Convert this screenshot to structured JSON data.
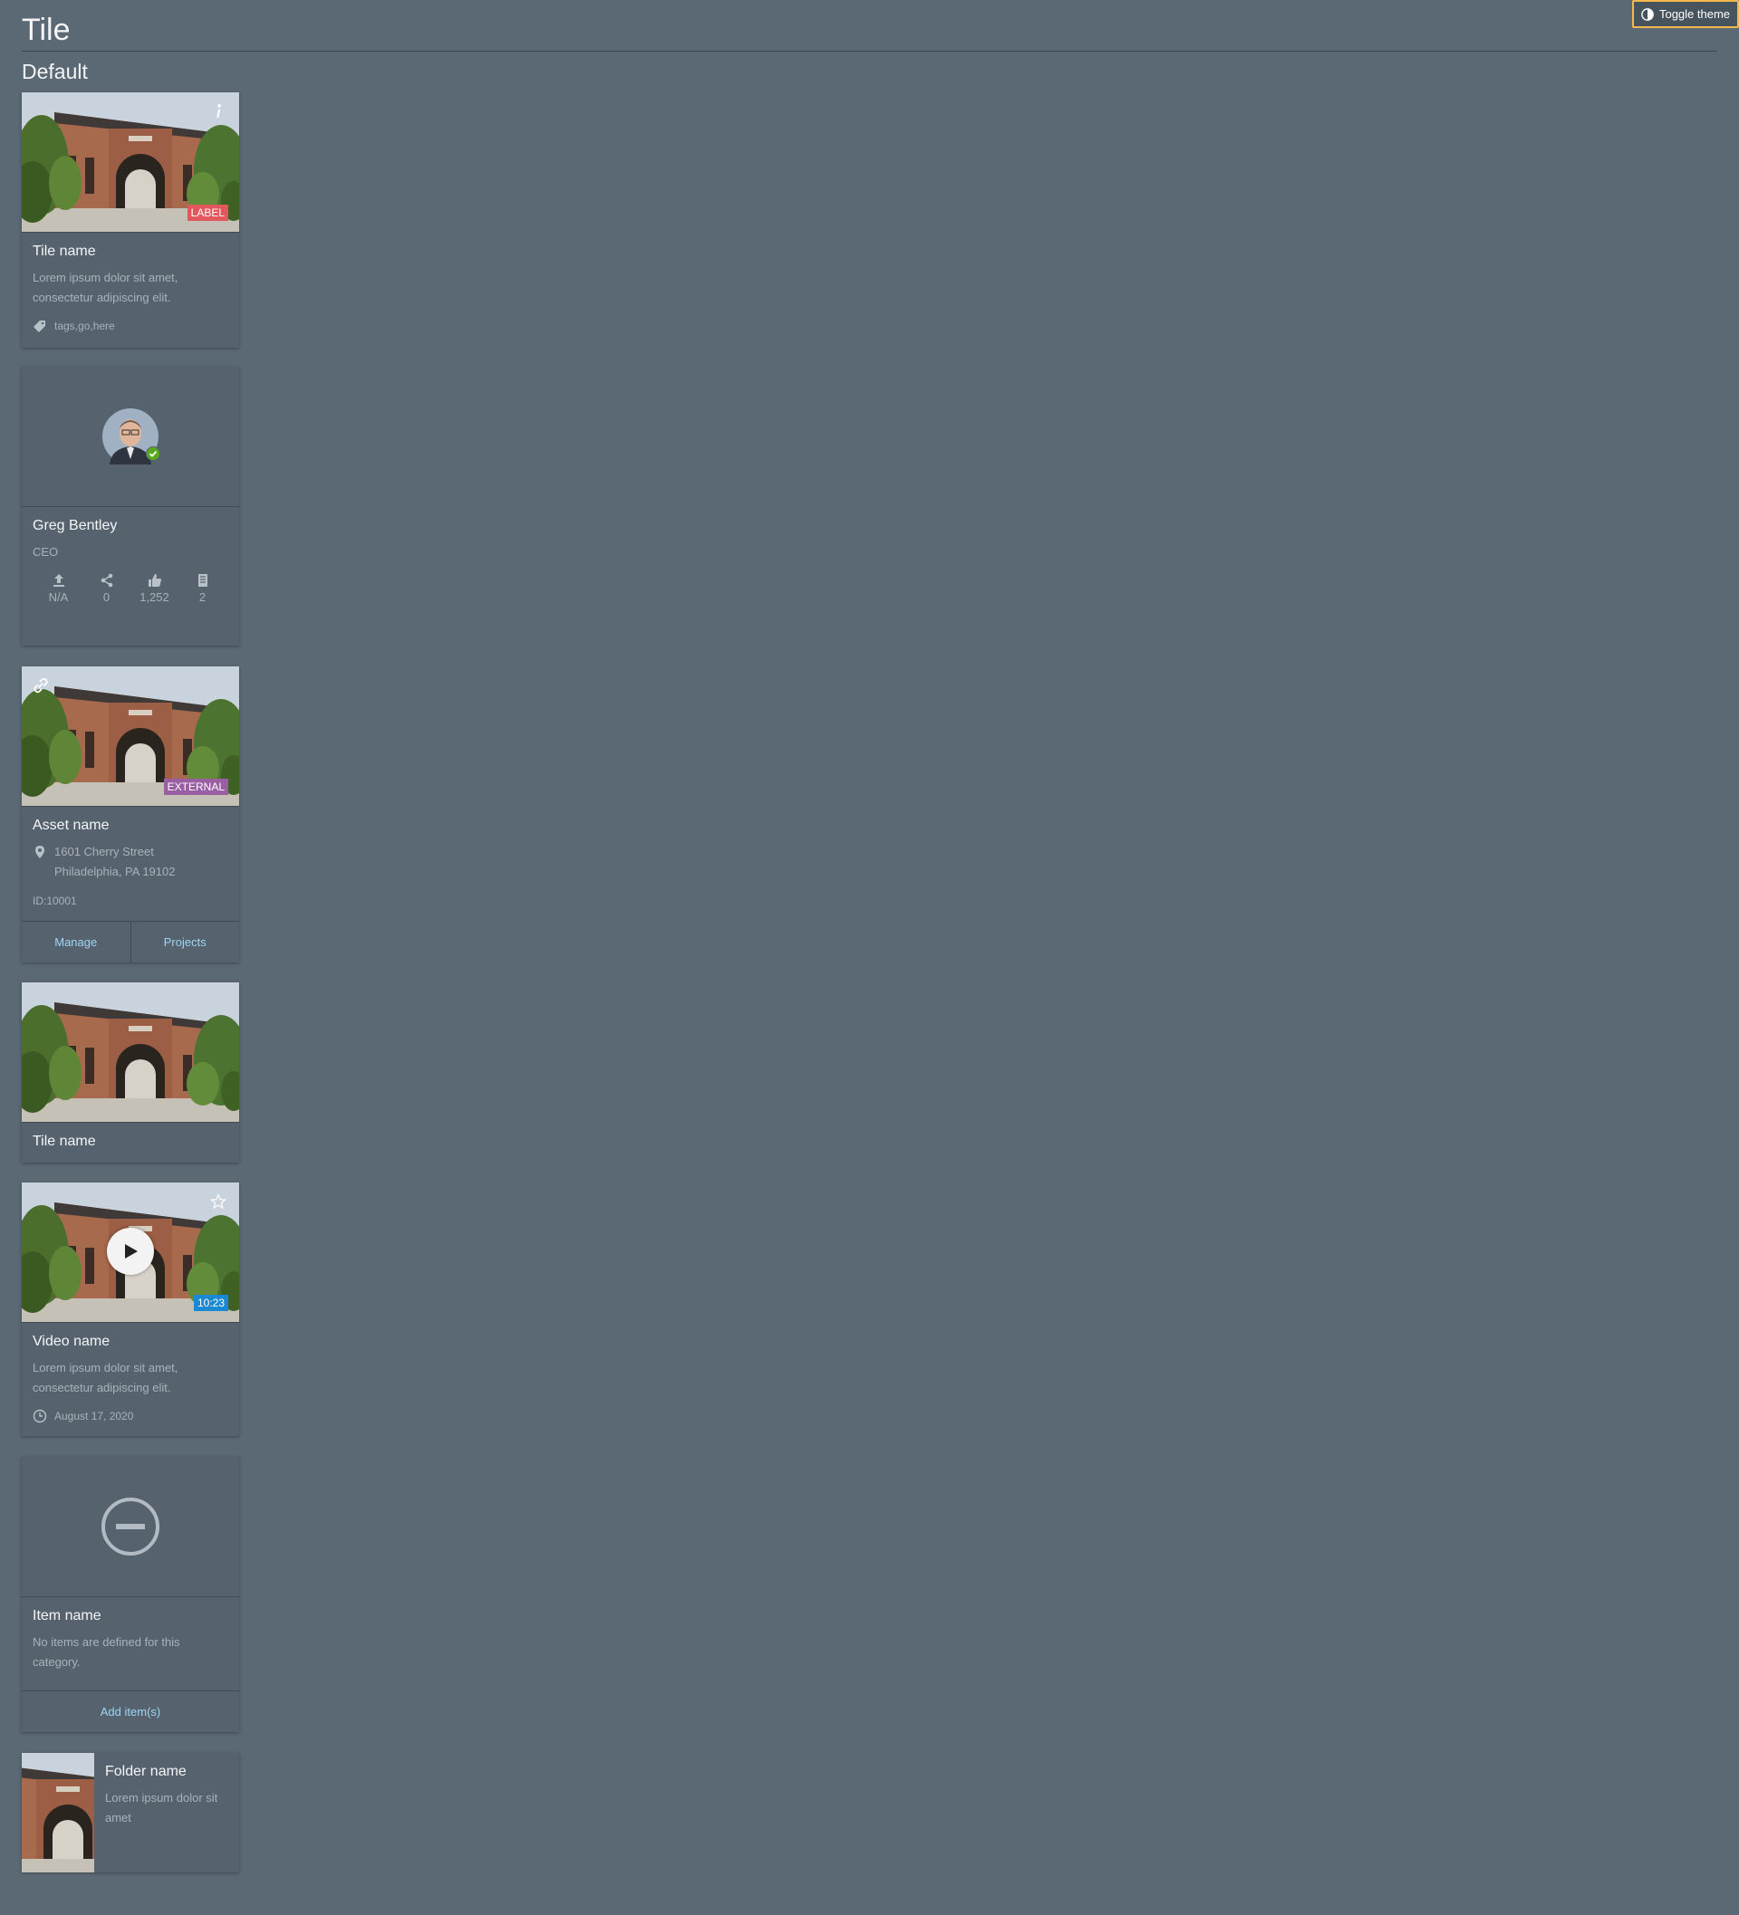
{
  "page": {
    "title": "Tile",
    "section": "Default"
  },
  "toolbar": {
    "toggle_theme": "Toggle theme"
  },
  "colors": {
    "background": "#5b6975",
    "tile": "#56636f",
    "accent_link": "#9fd4f2",
    "label_badge": "#e2575c",
    "external_badge": "#9a5fa3",
    "duration_badge": "#1a88d3",
    "online_status": "#56aa1c",
    "focus_outline": "#f5b94b"
  },
  "tiles": [
    {
      "name": "Tile name",
      "badge": "LABEL",
      "corner_icon": "info-icon",
      "description": "Lorem ipsum dolor sit amet, consectetur adipiscing elit.",
      "tags": "tags,go,here"
    },
    {
      "name": "Greg Bentley",
      "role": "CEO",
      "status_icon": "online-check-icon",
      "stats": [
        {
          "icon": "upload-icon",
          "value": "N/A"
        },
        {
          "icon": "share-icon",
          "value": "0"
        },
        {
          "icon": "thumbs-up-icon",
          "value": "1,252"
        },
        {
          "icon": "document-icon",
          "value": "2"
        }
      ]
    },
    {
      "name": "Asset name",
      "badge": "EXTERNAL",
      "corner_icon": "link-icon",
      "address_line1": "1601 Cherry Street",
      "address_line2": "Philadelphia, PA 19102",
      "id": "ID:10001",
      "buttons": [
        "Manage",
        "Projects"
      ]
    },
    {
      "name": "Tile name"
    },
    {
      "name": "Video name",
      "corner_icon": "star-icon",
      "duration": "10:23",
      "description": "Lorem ipsum dolor sit amet, consectetur adipiscing elit.",
      "date": "August 17, 2020"
    },
    {
      "name": "Item name",
      "icon": "no-entry-icon",
      "description": "No items are defined for this category.",
      "button": "Add item(s)"
    },
    {
      "name": "Folder name",
      "description": "Lorem ipsum dolor sit amet"
    }
  ]
}
